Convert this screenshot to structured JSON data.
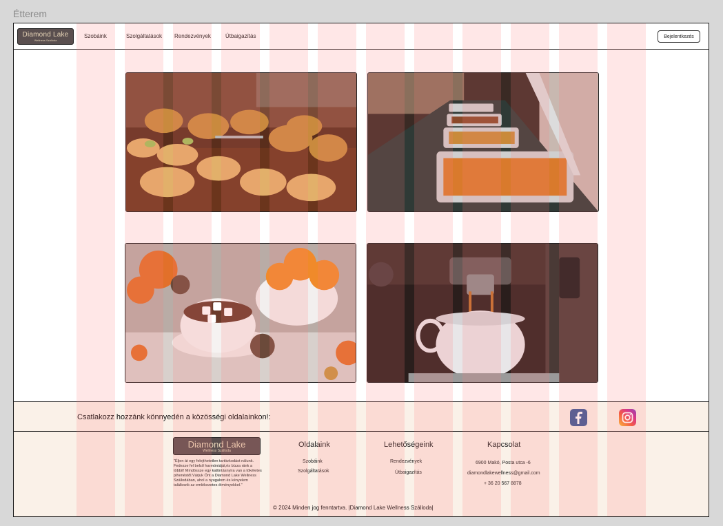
{
  "frame_label": "Étterem",
  "header": {
    "logo_title": "Diamond Lake",
    "logo_subtitle": "Wellness Szálloda",
    "nav": [
      "Szobáink",
      "Szolgáltatások",
      "Rendezvények",
      "Útbaigazítás"
    ],
    "login_label": "Bejelentkezés"
  },
  "gallery": [
    {
      "name": "croissants-photo"
    },
    {
      "name": "buffet-photo"
    },
    {
      "name": "hot-chocolate-photo"
    },
    {
      "name": "espresso-photo"
    }
  ],
  "social": {
    "text": "Csatlakozz hozzánk könnyedén a közösségi oldalainkon!:",
    "icons": [
      "facebook-icon",
      "instagram-icon"
    ]
  },
  "footer": {
    "logo_title": "Diamond Lake",
    "logo_subtitle": "Wellness Szálloda",
    "description": "\"Éljen át egy felejthetetlen tartózkodást nálunk. Fedezze fel belső harmóniáját,és bízza ránk a többit! Mindössze egy kattintásnyira van a tökéletes pihenéstől.Várjuk Önt a Diamond Lake Wellness Szállodában, ahol a nyugalom és kényelem találkozik az emlékezetes élményekkel.\"",
    "col1": {
      "title": "Oldalaink",
      "links": [
        "Szobáink",
        "Szolgáltatások"
      ]
    },
    "col2": {
      "title": "Lehetőségeink",
      "links": [
        "Rendezvények",
        "Útbaigazítás"
      ]
    },
    "col3": {
      "title": "Kapcsolat",
      "lines": [
        "6900 Makó, Posta utca -6",
        "diamondlakewellness@gmail.com",
        "+ 36 20 567 8878"
      ]
    },
    "copyright": "© 2024 Minden jog fenntartva. |Diamond Lake Wellness Szálloda|"
  },
  "colors": {
    "accent_logo": "#5a4f4f",
    "footer_bg": "#faf1e8",
    "grid_overlay": "#ff7878"
  }
}
